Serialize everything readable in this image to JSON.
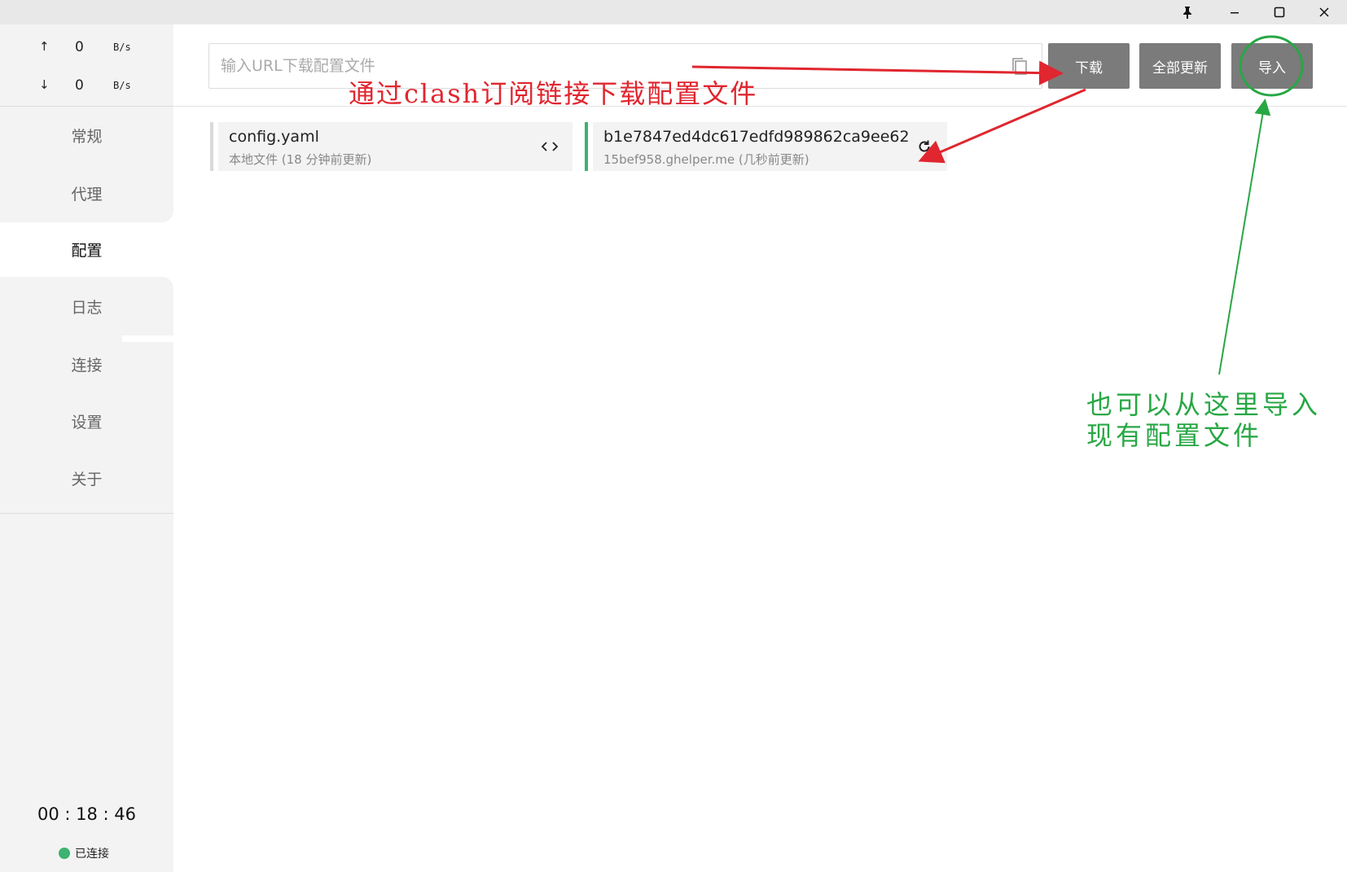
{
  "window": {
    "pin_icon": "pin-icon",
    "minimize_icon": "minimize-icon",
    "maximize_icon": "maximize-icon",
    "close_icon": "close-icon"
  },
  "traffic": {
    "up_arrow": "↑",
    "up_value": "0",
    "up_unit": "B/s",
    "down_arrow": "↓",
    "down_value": "0",
    "down_unit": "B/s"
  },
  "sidebar": {
    "items": [
      {
        "label": "常规"
      },
      {
        "label": "代理"
      },
      {
        "label": "配置"
      },
      {
        "label": "日志"
      },
      {
        "label": "连接"
      },
      {
        "label": "设置"
      },
      {
        "label": "关于"
      }
    ],
    "active_index": 2,
    "timer": "00 : 18 : 46",
    "status_text": "已连接",
    "status_color": "#3cb371"
  },
  "toolbar": {
    "url_placeholder": "输入URL下载配置文件",
    "url_value": "",
    "download_label": "下载",
    "update_all_label": "全部更新",
    "import_label": "导入"
  },
  "profiles": [
    {
      "name": "config.yaml",
      "sub": "本地文件 (18 分钟前更新)",
      "action_icon": "code-icon",
      "selected": false
    },
    {
      "name": "b1e7847ed4dc617edfd989862ca9ee62",
      "sub": "15bef958.ghelper.me (几秒前更新)",
      "action_icon": "refresh-icon",
      "selected": true
    }
  ],
  "annotations": {
    "red_text": "通过clash订阅链接下载配置文件",
    "green_line1": "也可以从这里导入",
    "green_line2": "现有配置文件",
    "red_color": "#e0262f",
    "green_color": "#28a745"
  },
  "colors": {
    "selected_bar": "#3cb371",
    "unselected_bar": "#d9d9d9",
    "button_bg": "#7b7b7b"
  }
}
